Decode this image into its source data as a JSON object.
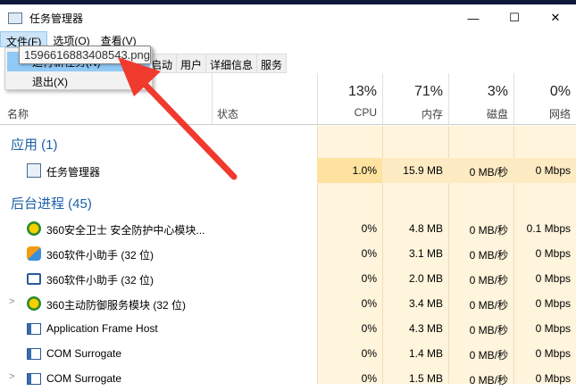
{
  "window": {
    "title": "任务管理器",
    "minimize": "—",
    "maximize": "☐",
    "close": "✕"
  },
  "menu": [
    "文件(F)",
    "选项(O)",
    "查看(V)"
  ],
  "file_menu": {
    "item1": "运行新任务(N)",
    "item2": "退出(X)"
  },
  "tooltip": "1596616883408543.png",
  "tabs": [
    "启动",
    "用户",
    "详细信息",
    "服务"
  ],
  "header": {
    "name": "名称",
    "status": "状态",
    "cpu": {
      "pct": "13%",
      "label": "CPU"
    },
    "mem": {
      "pct": "71%",
      "label": "内存"
    },
    "disk": {
      "pct": "3%",
      "label": "磁盘"
    },
    "net": {
      "pct": "0%",
      "label": "网络"
    }
  },
  "sections": {
    "apps": "应用 (1)",
    "bg": "后台进程 (45)"
  },
  "apps": [
    {
      "name": "任务管理器",
      "cpu": "1.0%",
      "mem": "15.9 MB",
      "disk": "0 MB/秒",
      "net": "0 Mbps"
    }
  ],
  "bg": [
    {
      "name": "360安全卫士 安全防护中心模块...",
      "cpu": "0%",
      "mem": "4.8 MB",
      "disk": "0 MB/秒",
      "net": "0.1 Mbps",
      "icon": "360-shield-icon"
    },
    {
      "name": "360软件小助手 (32 位)",
      "cpu": "0%",
      "mem": "3.1 MB",
      "disk": "0 MB/秒",
      "net": "0 Mbps",
      "icon": "360-helper-icon"
    },
    {
      "name": "360软件小助手 (32 位)",
      "cpu": "0%",
      "mem": "2.0 MB",
      "disk": "0 MB/秒",
      "net": "0 Mbps",
      "icon": "window-icon"
    },
    {
      "name": "360主动防御服务模块 (32 位)",
      "cpu": "0%",
      "mem": "3.4 MB",
      "disk": "0 MB/秒",
      "net": "0 Mbps",
      "icon": "360-shield-icon",
      "expand": true
    },
    {
      "name": "Application Frame Host",
      "cpu": "0%",
      "mem": "4.3 MB",
      "disk": "0 MB/秒",
      "net": "0 Mbps",
      "icon": "app-icon"
    },
    {
      "name": "COM Surrogate",
      "cpu": "0%",
      "mem": "1.4 MB",
      "disk": "0 MB/秒",
      "net": "0 Mbps",
      "icon": "app-icon"
    },
    {
      "name": "COM Surrogate",
      "cpu": "0%",
      "mem": "1.5 MB",
      "disk": "0 MB/秒",
      "net": "0 Mbps",
      "icon": "app-icon",
      "expand": true
    }
  ]
}
